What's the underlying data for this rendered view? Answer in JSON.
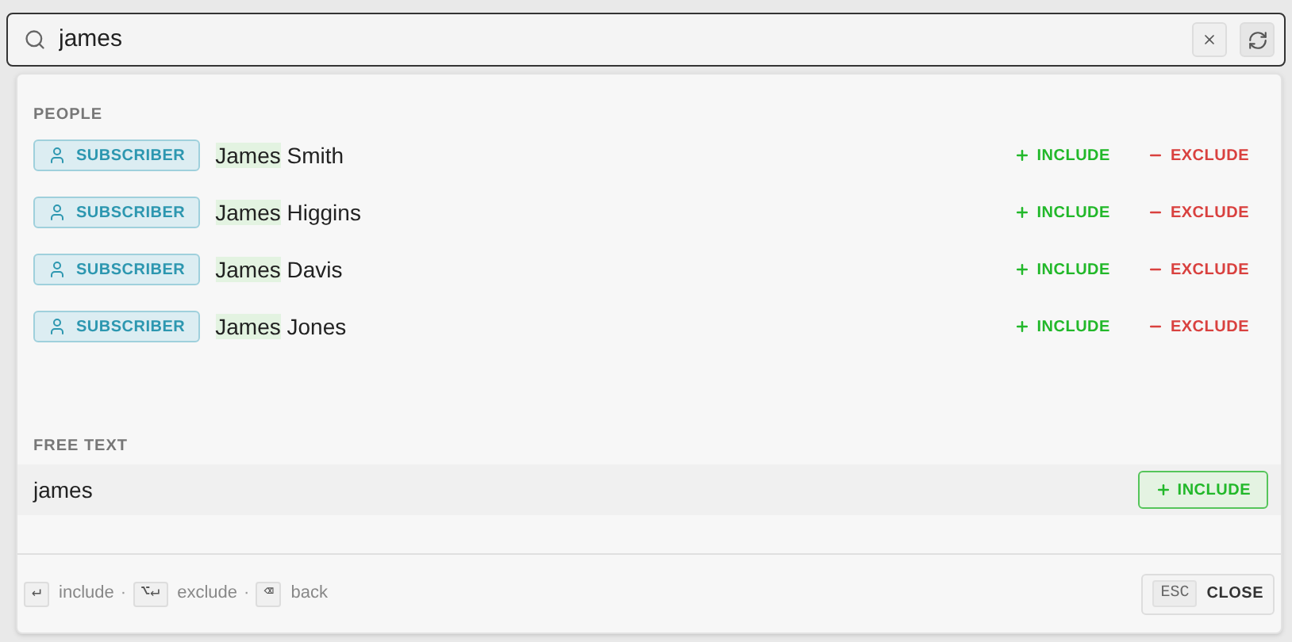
{
  "search": {
    "value": "james"
  },
  "people": {
    "heading": "PEOPLE",
    "rows": [
      {
        "badge": "SUBSCRIBER",
        "match": "James",
        "rest": "Smith",
        "include": "INCLUDE",
        "exclude": "EXCLUDE"
      },
      {
        "badge": "SUBSCRIBER",
        "match": "James",
        "rest": "Higgins",
        "include": "INCLUDE",
        "exclude": "EXCLUDE"
      },
      {
        "badge": "SUBSCRIBER",
        "match": "James",
        "rest": "Davis",
        "include": "INCLUDE",
        "exclude": "EXCLUDE"
      },
      {
        "badge": "SUBSCRIBER",
        "match": "James",
        "rest": "Jones",
        "include": "INCLUDE",
        "exclude": "EXCLUDE"
      }
    ]
  },
  "free_text": {
    "heading": "FREE TEXT",
    "value": "james",
    "include": "INCLUDE"
  },
  "footer": {
    "hints": [
      {
        "key": "↵",
        "label": "include",
        "separator": "·"
      },
      {
        "key": "⌥↵",
        "label": "exclude",
        "separator": "·"
      },
      {
        "key": "⌫",
        "label": "back"
      }
    ],
    "close_key": "ESC",
    "close_label": "CLOSE"
  }
}
